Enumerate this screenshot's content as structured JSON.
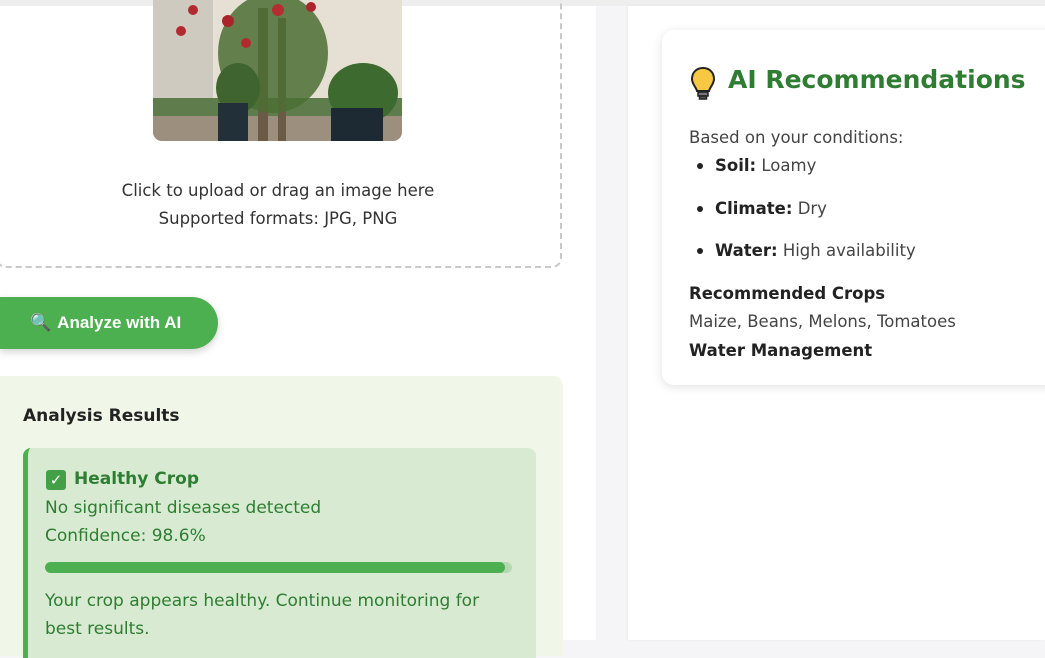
{
  "upload": {
    "line1": "Click to upload or drag an image here",
    "line2": "Supported formats: JPG, PNG"
  },
  "analyze_button": {
    "label": "Analyze with AI",
    "icon": "magnifier-icon"
  },
  "results": {
    "title": "Analysis Results",
    "status_title": "Healthy Crop",
    "status_icon": "check-icon",
    "description": "No significant diseases detected",
    "confidence_text": "Confidence: 98.6%",
    "confidence_value": 0.986,
    "advice": "Your crop appears healthy. Continue monitoring for best results."
  },
  "recommendations": {
    "icon": "lightbulb-icon",
    "title": "AI Recommendations",
    "intro": "Based on your conditions:",
    "conditions": [
      {
        "label": "Soil:",
        "value": "Loamy"
      },
      {
        "label": "Climate:",
        "value": "Dry"
      },
      {
        "label": "Water:",
        "value": "High availability"
      }
    ],
    "crops_heading": "Recommended Crops",
    "crops": "Maize, Beans, Melons, Tomatoes",
    "water_heading": "Water Management"
  },
  "colors": {
    "accent": "#4caf50",
    "accent_dark": "#2e7d32",
    "result_bg": "#f0f6e8",
    "result_card_bg": "#d8ebd2"
  }
}
